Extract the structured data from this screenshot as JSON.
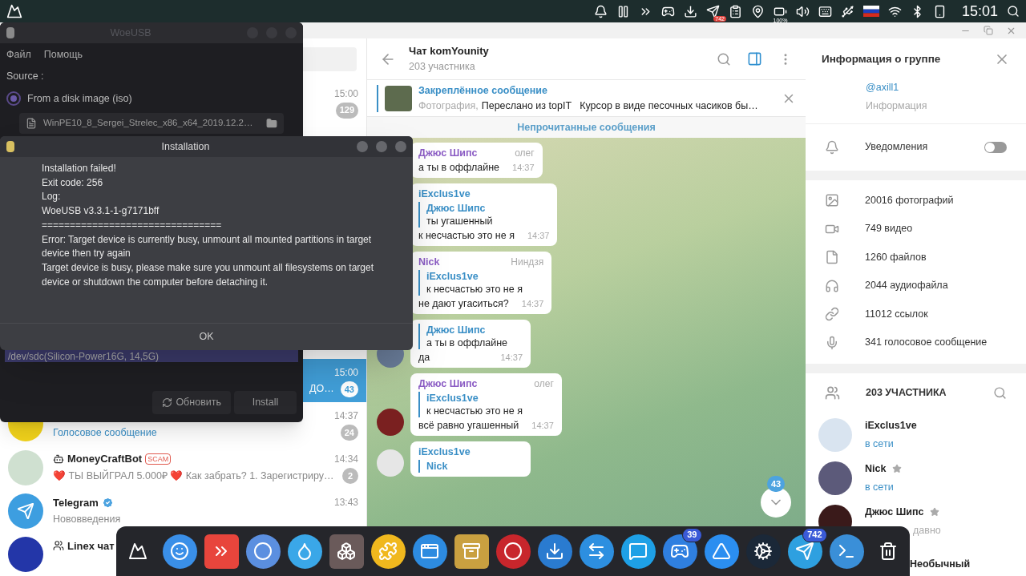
{
  "top_panel": {
    "clock": "15:01",
    "tray": [
      {
        "kind": "bell"
      },
      {
        "kind": "pause"
      },
      {
        "kind": "remote"
      },
      {
        "kind": "gamepad"
      },
      {
        "kind": "torrent"
      },
      {
        "kind": "app",
        "badge": "742"
      },
      {
        "kind": "clipboard"
      },
      {
        "kind": "location"
      },
      {
        "kind": "battery",
        "label": "100%"
      },
      {
        "kind": "volume"
      },
      {
        "kind": "keyboard"
      },
      {
        "kind": "usb"
      },
      {
        "kind": "flag"
      },
      {
        "kind": "wifi"
      },
      {
        "kind": "bluetooth"
      },
      {
        "kind": "phone"
      }
    ]
  },
  "woeusb": {
    "title": "WoeUSB",
    "menu": [
      "Файл",
      "Помощь"
    ],
    "source_label": "Source :",
    "source_option": {
      "label": "From a disk image (iso)",
      "selected": true
    },
    "image_file": "WinPE10_8_Sergei_Strelec_x86_x64_2019.12.2…",
    "target_device": {
      "label": "/dev/sdc(Silicon-Power16G, 14,5G)",
      "selected": true
    },
    "buttons": [
      {
        "label": "Обновить",
        "kind": "refresh"
      },
      {
        "label": "Install",
        "kind": "plain"
      }
    ]
  },
  "dialog": {
    "title": "Installation",
    "lines": [
      "Installation failed!",
      "Exit code: 256",
      "Log:",
      "WoeUSB v3.3.1-1-g7171bff",
      "================================",
      "Error: Target device is currently busy, unmount all mounted partitions in target device then try again",
      "Target device is busy, please make sure you unmount all filesystems on target device or shutdown the computer before detaching it."
    ],
    "button": "OK"
  },
  "telegram": {
    "chat_list": [
      {
        "time": "15:00",
        "unread": "129",
        "muted": true,
        "selected": false
      },
      {
        "preview": "ДО…",
        "time": "15:00",
        "unread": "43",
        "selected": true
      },
      {
        "preview": "Голосовое сообщение",
        "time": "14:37",
        "unread": "24",
        "muted": true,
        "selected": false
      },
      {
        "name": "MoneyCraftBot",
        "kind": "bot",
        "tag": "SCAM",
        "preview": "❤️ ТЫ ВЫЙГРАЛ 5.000₽ ❤️  Как забрать?  1. Зарегистриру…",
        "time": "14:34",
        "unread": "2",
        "muted": true,
        "selected": false
      },
      {
        "name": "Telegram",
        "kind": "verified",
        "preview": "Нововведения",
        "time": "13:43",
        "selected": false
      },
      {
        "name": "Linex чат",
        "kind": "group",
        "selected": false
      }
    ],
    "chat": {
      "title": "Чат komYounity",
      "subtitle": "203 участника",
      "sidebar_open": true,
      "pinned": {
        "title": "Закреплённое сообщение",
        "media": "Фотография,",
        "text": "Переслано из topIT   Курсор в виде песочных часиков бы…"
      },
      "unread_bar": "Непрочитанные сообщения",
      "messages": [
        {
          "author": "Джюс Шипс",
          "color": "#8b5cc4",
          "title": "олег",
          "text": "а ты в оффлайне",
          "time": "14:37"
        },
        {
          "author": "iExclus1ve",
          "color": "#3a8fc6",
          "reply": {
            "author": "Джюс Шипс",
            "text": "ты угашенный"
          },
          "text": "к несчастью это не я",
          "time": "14:37"
        },
        {
          "author": "Nick",
          "color": "#8b5cc4",
          "title": "Ниндзя",
          "reply": {
            "author": "iExclus1ve",
            "text": "к несчастью это не я"
          },
          "text": "не дают угаситься?",
          "time": "14:37"
        },
        {
          "reply": {
            "author": "Джюс Шипс",
            "text": "а ты в оффлайне"
          },
          "text": "да",
          "time": "14:37"
        },
        {
          "author": "Джюс Шипс",
          "color": "#8b5cc4",
          "title": "олег",
          "reply": {
            "author": "iExclus1ve",
            "text": "к несчастью это не я"
          },
          "text": "всё равно угашенный",
          "time": "14:37"
        },
        {
          "author": "iExclus1ve",
          "color": "#3a8fc6",
          "reply": {
            "author": "Nick"
          }
        }
      ],
      "scroll_badge": "43"
    },
    "info": {
      "title": "Информация о группе",
      "username": "@axill1",
      "username_caption": "Информация",
      "notifications": {
        "label": "Уведомления",
        "on": false
      },
      "media": [
        {
          "kind": "photo",
          "label": "20016 фотографий"
        },
        {
          "kind": "video",
          "label": "749 видео"
        },
        {
          "kind": "file",
          "label": "1260 файлов"
        },
        {
          "kind": "audio",
          "label": "2044 аудиофайла"
        },
        {
          "kind": "link",
          "label": "11012 ссылок"
        },
        {
          "kind": "voice",
          "label": "341 голосовое сообщение"
        }
      ],
      "members_header": "203 УЧАСТНИКА",
      "members": [
        {
          "name": "iExclus1ve",
          "status": "в сети",
          "online": true,
          "admin": false
        },
        {
          "name": "Nick",
          "status": "в сети",
          "online": true,
          "admin": true
        },
        {
          "name": "Джюс Шипс",
          "status": "давно",
          "online": false,
          "admin": true
        },
        {
          "name": "Необычный",
          "admin": false
        }
      ]
    }
  },
  "dock": [
    {
      "kind": "mountains"
    },
    {
      "kind": "finder"
    },
    {
      "kind": "remote"
    },
    {
      "kind": "browser"
    },
    {
      "kind": "drop"
    },
    {
      "kind": "boxes"
    },
    {
      "kind": "puzzle"
    },
    {
      "kind": "windows"
    },
    {
      "kind": "archive"
    },
    {
      "kind": "ring"
    },
    {
      "kind": "torrent"
    },
    {
      "kind": "arrows"
    },
    {
      "kind": "chat"
    },
    {
      "kind": "gamepad",
      "badge": "39"
    },
    {
      "kind": "store"
    },
    {
      "kind": "steam"
    },
    {
      "kind": "send",
      "badge": "742"
    },
    {
      "kind": "terminal"
    },
    {
      "kind": "trash"
    }
  ]
}
